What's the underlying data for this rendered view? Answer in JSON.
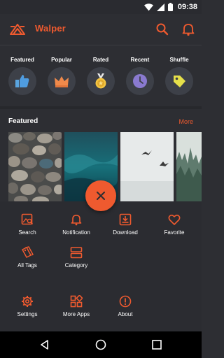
{
  "status_bar": {
    "time": "09:38"
  },
  "app_bar": {
    "title": "Walper"
  },
  "categories": [
    {
      "label": "Featured",
      "icon": "thumbs-up-icon"
    },
    {
      "label": "Popular",
      "icon": "crown-icon"
    },
    {
      "label": "Rated",
      "icon": "medal-icon"
    },
    {
      "label": "Recent",
      "icon": "clock-icon"
    },
    {
      "label": "Shuffle",
      "icon": "tag-icon"
    }
  ],
  "featured_section": {
    "title": "Featured",
    "more_label": "More"
  },
  "menu": {
    "search": "Search",
    "notification": "Notification",
    "download": "Download",
    "favorite": "Favorite",
    "all_tags": "All Tags",
    "category": "Category",
    "settings": "Settings",
    "more_apps": "More Apps",
    "about": "About"
  },
  "colors": {
    "accent": "#ef5a2f",
    "background": "#2d2e33"
  }
}
